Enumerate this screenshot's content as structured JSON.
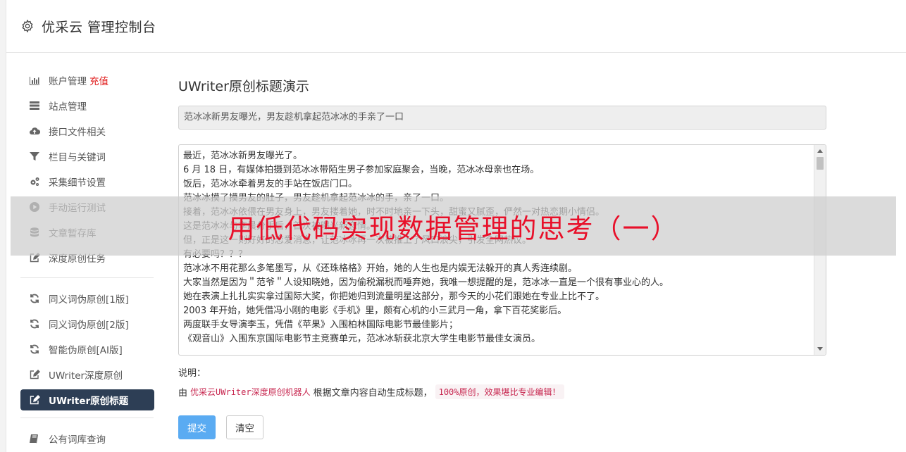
{
  "header": {
    "title": "优采云 管理控制台"
  },
  "sidebar": {
    "group1": [
      {
        "label": "账户管理",
        "extra": "充值",
        "icon": "bar-chart-icon"
      },
      {
        "label": "站点管理",
        "icon": "server-icon"
      },
      {
        "label": "接口文件相关",
        "icon": "cloud-upload-icon"
      },
      {
        "label": "栏目与关键词",
        "icon": "filter-icon"
      },
      {
        "label": "采集细节设置",
        "icon": "cogs-icon"
      },
      {
        "label": "手动运行测试",
        "icon": "play-circle-icon"
      },
      {
        "label": "文章暂存库",
        "icon": "database-icon"
      },
      {
        "label": "深度原创任务",
        "icon": "edit-icon"
      }
    ],
    "group2": [
      {
        "label": "同义词伪原创[1版]",
        "icon": "refresh-icon"
      },
      {
        "label": "同义词伪原创[2版]",
        "icon": "refresh-icon"
      },
      {
        "label": "智能伪原创[AI版]",
        "icon": "refresh-icon"
      },
      {
        "label": "UWriter深度原创",
        "icon": "edit-icon"
      },
      {
        "label": "UWriter原创标题",
        "icon": "edit-icon",
        "active": true
      }
    ],
    "group3": [
      {
        "label": "公有词库查询",
        "icon": "book-icon"
      }
    ]
  },
  "main": {
    "heading": "UWriter原创标题演示",
    "title_value": "范冰冰新男友曝光，男友趁机拿起范冰冰的手亲了一口",
    "content_lines": [
      "最近，范冰冰新男友曝光了。",
      "6 月 18 日，有媒体拍摄到范冰冰带陌生男子参加家庭聚会，当晚，范冰冰母亲也在场。",
      "饭后，范冰冰牵着男友的手站在饭店门口。",
      "范冰冰摸了摸男友的肚子，男友趁机拿起范冰冰的手，亲了一口。",
      "接着，范冰冰依偎在男友身上，男友搂着她，时不时地亲一下头，甜蜜又腻歪，俨然一对热恋期小情侣。",
      "这是范冰冰与李晨分手后，首次被曝光新恋情。",
      "但，正是这一则好好的恋爱消息，让范冰冰再一次被推上了风口浪尖，引发全网热议。",
      "有必要吗？？？",
      "范冰冰不用花那么多笔墨写，从《还珠格格》开始，她的人生也是内娱无法躲开的真人秀连续剧。",
      "大家当然是因为＂范爷＂人设知晓她，因为偷税漏税而唾弃她，我唯一想提醒的是，范冰冰一直是一个很有事业心的人。",
      "她在表演上扎扎实实拿过国际大奖，你把她归到流量明星这部分，那今天的小花们跟她在专业上比不了。",
      "2003 年开始，她凭借冯小刚的电影《手机》里，颇有心机的小三武月一角，拿下百花奖影后。",
      "两度联手女导演李玉，凭借《苹果》入围柏林国际电影节最佳影片；",
      "《观音山》入围东京国际电影节主竞赛单元，范冰冰斩获北京大学生电影节最佳女演员。"
    ],
    "note_label": "说明：",
    "note_prefix": "由",
    "note_highlight": "优采云UWriter深度原创机器人",
    "note_middle": "根据文章内容自动生成标题，",
    "note_code": "100%原创，效果堪比专业编辑！",
    "submit_label": "提交",
    "clear_label": "清空"
  },
  "overlay": {
    "text": "用低代码实现数据管理的思考（一）"
  }
}
